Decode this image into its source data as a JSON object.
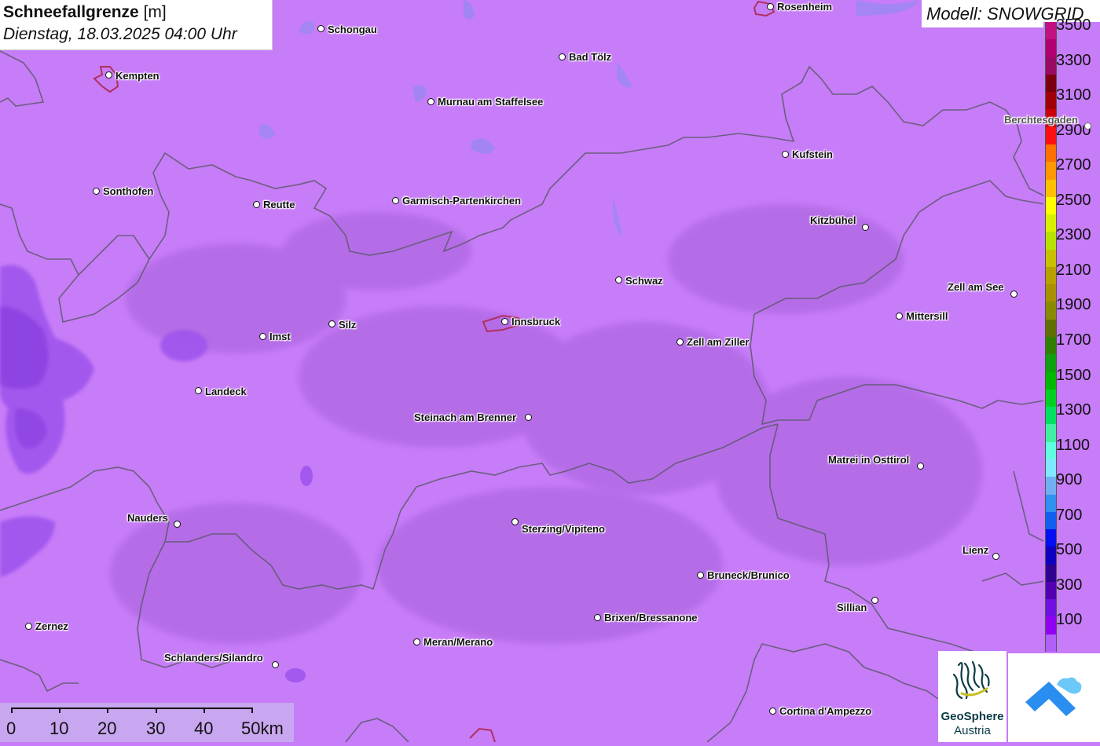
{
  "header": {
    "title_bold": "Schneefallgrenze",
    "title_unit": " [m]",
    "datetime": "Dienstag, 18.03.2025 04:00 Uhr"
  },
  "model": {
    "label": "Modell: SNOWGRID"
  },
  "legend": {
    "labels": [
      "3500",
      "3300",
      "3100",
      "2900",
      "2700",
      "2500",
      "2300",
      "2100",
      "1900",
      "1700",
      "1500",
      "1300",
      "1100",
      "900",
      "700",
      "500",
      "300",
      "100"
    ],
    "colors": [
      "#c21080",
      "#b00070",
      "#9a0a60",
      "#7a0010",
      "#a00008",
      "#c8000a",
      "#ff1010",
      "#ff7000",
      "#ff9800",
      "#ffc000",
      "#ffff00",
      "#d8f000",
      "#b8e000",
      "#c8c000",
      "#b8a000",
      "#a89000",
      "#8a8a00",
      "#607000",
      "#308000",
      "#10a010",
      "#00b800",
      "#00d020",
      "#00e060",
      "#40f0a0",
      "#60ffe0",
      "#80e8ff",
      "#70b0f0",
      "#3090f0",
      "#1060f0",
      "#0010f0",
      "#1000c0",
      "#300090",
      "#5000b0",
      "#7010e0",
      "#9000f0",
      "#b060f8"
    ]
  },
  "cities": [
    {
      "name": "Schongau"
    },
    {
      "name": "Rosenheim"
    },
    {
      "name": "Kempten"
    },
    {
      "name": "Bad Tölz"
    },
    {
      "name": "Murnau am Staffelsee"
    },
    {
      "name": "Berchtesgaden"
    },
    {
      "name": "Kufstein"
    },
    {
      "name": "Sonthofen"
    },
    {
      "name": "Reutte"
    },
    {
      "name": "Garmisch-Partenkirchen"
    },
    {
      "name": "Kitzbühel"
    },
    {
      "name": "Schwaz"
    },
    {
      "name": "Zell am See"
    },
    {
      "name": "Mittersill"
    },
    {
      "name": "Imst"
    },
    {
      "name": "Silz"
    },
    {
      "name": "Innsbruck"
    },
    {
      "name": "Zell am Ziller"
    },
    {
      "name": "Landeck"
    },
    {
      "name": "Steinach am Brenner"
    },
    {
      "name": "Matrei in Osttirol"
    },
    {
      "name": "Nauders"
    },
    {
      "name": "Sterzing/Vipiteno"
    },
    {
      "name": "Lienz"
    },
    {
      "name": "Bruneck/Brunico"
    },
    {
      "name": "Sillian"
    },
    {
      "name": "Brixen/Bressanone"
    },
    {
      "name": "Zernez"
    },
    {
      "name": "Meran/Merano"
    },
    {
      "name": "Schlanders/Silandro"
    },
    {
      "name": "Cortina d'Ampezzo"
    }
  ],
  "scale": {
    "labels": [
      "0",
      "10",
      "20",
      "30",
      "40",
      "50km"
    ]
  },
  "logos": {
    "geosphere_line1": "GeoSphere",
    "geosphere_line2": "Austria"
  }
}
